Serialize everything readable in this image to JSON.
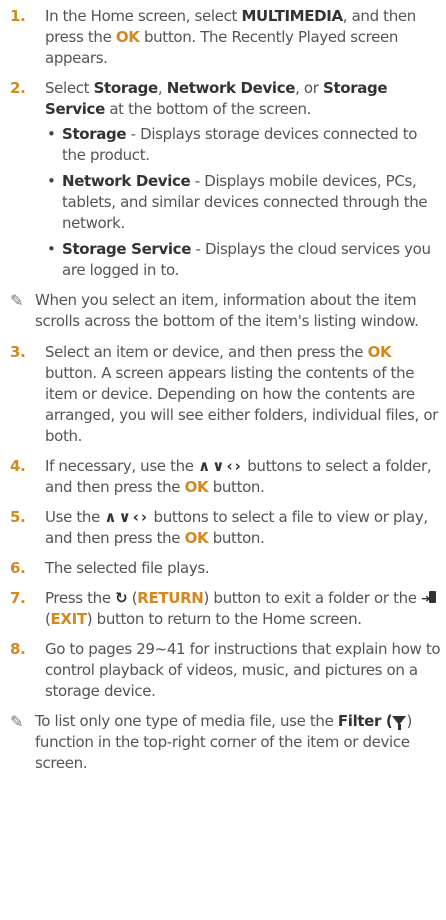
{
  "steps": [
    {
      "num": "1.",
      "t1": "In the Home screen, select ",
      "kw1": "MULTIMEDIA",
      "t2": ", and then press the ",
      "btn": "OK",
      "t3": " button. The Recently Played screen appears."
    },
    {
      "num": "2.",
      "kw1": "Select ",
      "k1": "Storage",
      "c1": ", ",
      "k2": "Network Device",
      "c2": ", or ",
      "k3": "Storage Service",
      "t": " at the bottom of the screen.",
      "subs": [
        {
          "label": "Storage",
          "text": " - Displays storage devices connected to the product."
        },
        {
          "label": "Network Device",
          "text": " - Displays mobile devices, PCs, tablets, and similar devices connected through the network."
        },
        {
          "label": "Storage Service",
          "text": " - Displays the cloud services you are logged in to."
        }
      ]
    },
    {
      "num": "3.",
      "t1": "Select an item or device, and then press the ",
      "btn": "OK",
      "t2": " button. A screen appears listing the contents of the item or device. Depending on how the contents are arranged, you will see either folders, individual files, or both."
    },
    {
      "num": "4.",
      "t1": "If necessary, use the ",
      "arrows": "∧∨‹›",
      "t2": " buttons to select a folder, and then press the ",
      "btn": "OK",
      "t3": " button."
    },
    {
      "num": "5.",
      "t1": "Use the ",
      "arrows": "∧∨‹›",
      "t2": " buttons to select a file to view or play, and then press the ",
      "btn": "OK",
      "t3": " button."
    },
    {
      "num": "6.",
      "t1": "The selected file plays."
    },
    {
      "num": "7.",
      "t1": "Press the ",
      "ret_icon": "↻",
      "p1": " (",
      "ret": "RETURN",
      "p2": ") button to exit a folder or the ",
      "p3": " (",
      "exit": "EXIT",
      "p4": ") button to return to the Home screen."
    },
    {
      "num": "8.",
      "t1": "Go to pages 29~41 for instructions that explain how to control playback of videos, music, and pictures on a storage device."
    }
  ],
  "note1": "When you select an item, information about the item scrolls across the bottom of the item's listing window.",
  "note2": {
    "t1": "To list only one type of media file, use the ",
    "kw": "Filter",
    "t2": " (",
    "t3": ") function in the top-right corner of the item or device screen."
  },
  "icons": {
    "note": "pencil-note-icon",
    "bullet": "bullet-dot",
    "return": "return-icon",
    "exit": "exit-icon",
    "filter": "filter-icon"
  },
  "colors": {
    "step_number": "#d4881f",
    "button_text": "#d4881f",
    "body_text": "#555555",
    "keyword": "#333333"
  }
}
